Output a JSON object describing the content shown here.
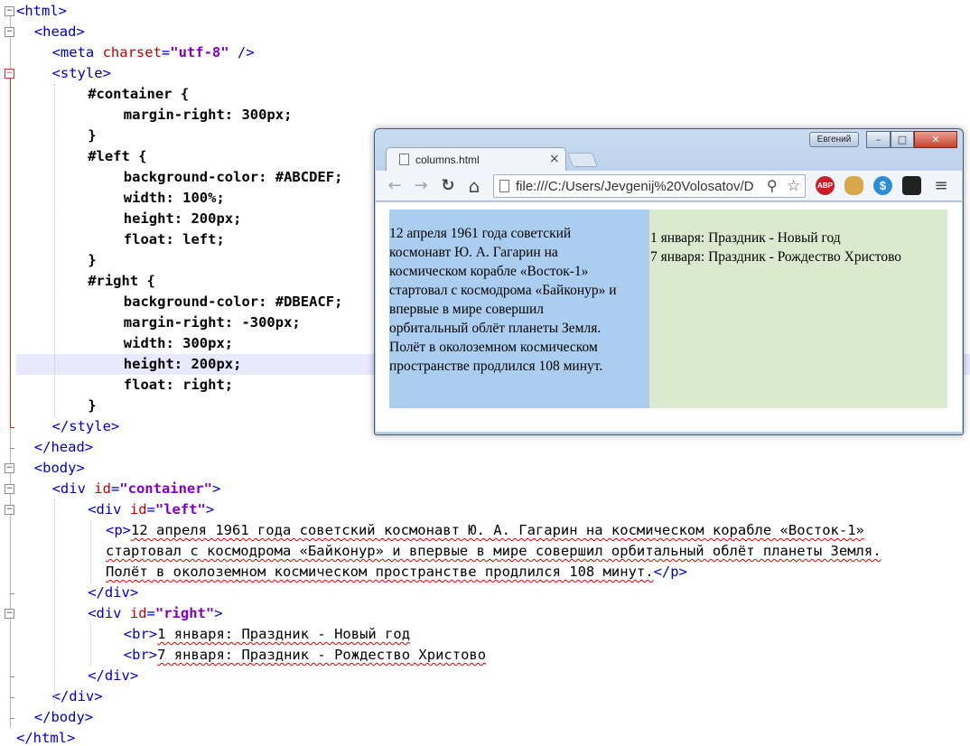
{
  "editor": {
    "lines": [
      {
        "indent": 0,
        "parts": [
          [
            "tag",
            "<html>"
          ]
        ]
      },
      {
        "indent": 1,
        "parts": [
          [
            "tag",
            "<head>"
          ]
        ]
      },
      {
        "indent": 2,
        "parts": [
          [
            "tag",
            "<meta "
          ],
          [
            "attr",
            "charset"
          ],
          [
            "tag",
            "="
          ],
          [
            "val",
            "\"utf-8\""
          ],
          [
            "tag",
            " />"
          ]
        ]
      },
      {
        "indent": 2,
        "parts": [
          [
            "tag",
            "<style>"
          ]
        ]
      },
      {
        "indent": 4,
        "parts": [
          [
            "bold",
            "#container {"
          ]
        ]
      },
      {
        "indent": 6,
        "parts": [
          [
            "bold",
            "margin-right: 300px;"
          ]
        ]
      },
      {
        "indent": 4,
        "parts": [
          [
            "bold",
            "}"
          ]
        ]
      },
      {
        "indent": 4,
        "parts": [
          [
            "bold",
            "#left {"
          ]
        ]
      },
      {
        "indent": 6,
        "parts": [
          [
            "bold",
            "background-color: #ABCDEF;"
          ]
        ]
      },
      {
        "indent": 6,
        "parts": [
          [
            "bold",
            "width: 100%;"
          ]
        ]
      },
      {
        "indent": 6,
        "parts": [
          [
            "bold",
            "height: 200px;"
          ]
        ]
      },
      {
        "indent": 6,
        "parts": [
          [
            "bold",
            "float: left;"
          ]
        ]
      },
      {
        "indent": 4,
        "parts": [
          [
            "bold",
            "}"
          ]
        ]
      },
      {
        "indent": 4,
        "parts": [
          [
            "bold",
            "#right {"
          ]
        ]
      },
      {
        "indent": 6,
        "parts": [
          [
            "bold",
            "background-color: #DBEACF;"
          ]
        ]
      },
      {
        "indent": 6,
        "parts": [
          [
            "bold",
            "margin-right: -300px;"
          ]
        ]
      },
      {
        "indent": 6,
        "parts": [
          [
            "bold",
            "width: 300px;"
          ]
        ]
      },
      {
        "indent": 6,
        "parts": [
          [
            "bold",
            "height: 200px;"
          ]
        ]
      },
      {
        "indent": 6,
        "parts": [
          [
            "bold",
            "float: right;"
          ]
        ]
      },
      {
        "indent": 4,
        "parts": [
          [
            "bold",
            "}"
          ]
        ]
      },
      {
        "indent": 2,
        "parts": [
          [
            "tag",
            "</style>"
          ]
        ]
      },
      {
        "indent": 1,
        "parts": [
          [
            "tag",
            "</head>"
          ]
        ]
      },
      {
        "indent": 1,
        "parts": [
          [
            "tag",
            "<body>"
          ]
        ]
      },
      {
        "indent": 2,
        "parts": [
          [
            "tag",
            "<div "
          ],
          [
            "attr",
            "id"
          ],
          [
            "tag",
            "="
          ],
          [
            "val",
            "\"container\""
          ],
          [
            "tag",
            ">"
          ]
        ]
      },
      {
        "indent": 4,
        "parts": [
          [
            "tag",
            "<div "
          ],
          [
            "attr",
            "id"
          ],
          [
            "tag",
            "="
          ],
          [
            "val",
            "\"left\""
          ],
          [
            "tag",
            ">"
          ]
        ]
      },
      {
        "indent": 5,
        "parts": [
          [
            "tag",
            "<p>"
          ],
          [
            "squig",
            "12 апреля 1961 года советский космонавт Ю. А. Гагарин на космическом корабле «Восток-1»"
          ]
        ]
      },
      {
        "indent": 5,
        "parts": [
          [
            "squig",
            "стартовал с космодрома «Байконур» и впервые в мире совершил орбитальный облёт планеты Земля."
          ]
        ]
      },
      {
        "indent": 5,
        "parts": [
          [
            "squig",
            "Полёт в околоземном космическом пространстве продлился 108 минут."
          ],
          [
            "tag",
            "</p>"
          ]
        ]
      },
      {
        "indent": 4,
        "parts": [
          [
            "tag",
            "</div>"
          ]
        ]
      },
      {
        "indent": 4,
        "parts": [
          [
            "tag",
            "<div "
          ],
          [
            "attr",
            "id"
          ],
          [
            "tag",
            "="
          ],
          [
            "val",
            "\"right\""
          ],
          [
            "tag",
            ">"
          ]
        ]
      },
      {
        "indent": 6,
        "parts": [
          [
            "tag",
            "<br>"
          ],
          [
            "squig",
            "1 января: Праздник - Новый год"
          ]
        ]
      },
      {
        "indent": 6,
        "parts": [
          [
            "tag",
            "<br>"
          ],
          [
            "squig",
            "7 января: Праздник - Рождество Христово"
          ]
        ]
      },
      {
        "indent": 4,
        "parts": [
          [
            "tag",
            "</div>"
          ]
        ]
      },
      {
        "indent": 2,
        "parts": [
          [
            "tag",
            "</div>"
          ]
        ]
      },
      {
        "indent": 1,
        "parts": [
          [
            "tag",
            "</body>"
          ]
        ]
      },
      {
        "indent": 0,
        "parts": [
          [
            "tag",
            "</html>"
          ]
        ]
      }
    ],
    "highlighted_line": 17
  },
  "browser": {
    "user_badge": "Евгений",
    "tab_title": "columns.html",
    "tab_close": "×",
    "url": "file:///C:/Users/Jevgenij%20Volosatov/D",
    "ext_abp": "ABP",
    "ext_s": "$",
    "controls": {
      "minimize": "–",
      "maximize": "□",
      "close": "✕"
    },
    "icons": {
      "back": "←",
      "forward": "→",
      "reload": "↻",
      "home": "⌂",
      "zoom": "⚲",
      "star": "☆",
      "menu": "≡"
    },
    "page": {
      "left_lines": [
        "12 апреля 1961 года советский",
        "космонавт Ю. А. Гагарин на",
        "космическом корабле «Восток-1»",
        "стартовал с космодрома «Байконур» и",
        "впервые в мире совершил",
        "орбитальный облёт планеты Земля.",
        "Полёт в околоземном космическом",
        "пространстве продлился 108 минут."
      ],
      "right_lines": [
        "1 января: Праздник - Новый год",
        "7 января: Праздник - Рождество Христово"
      ]
    }
  }
}
